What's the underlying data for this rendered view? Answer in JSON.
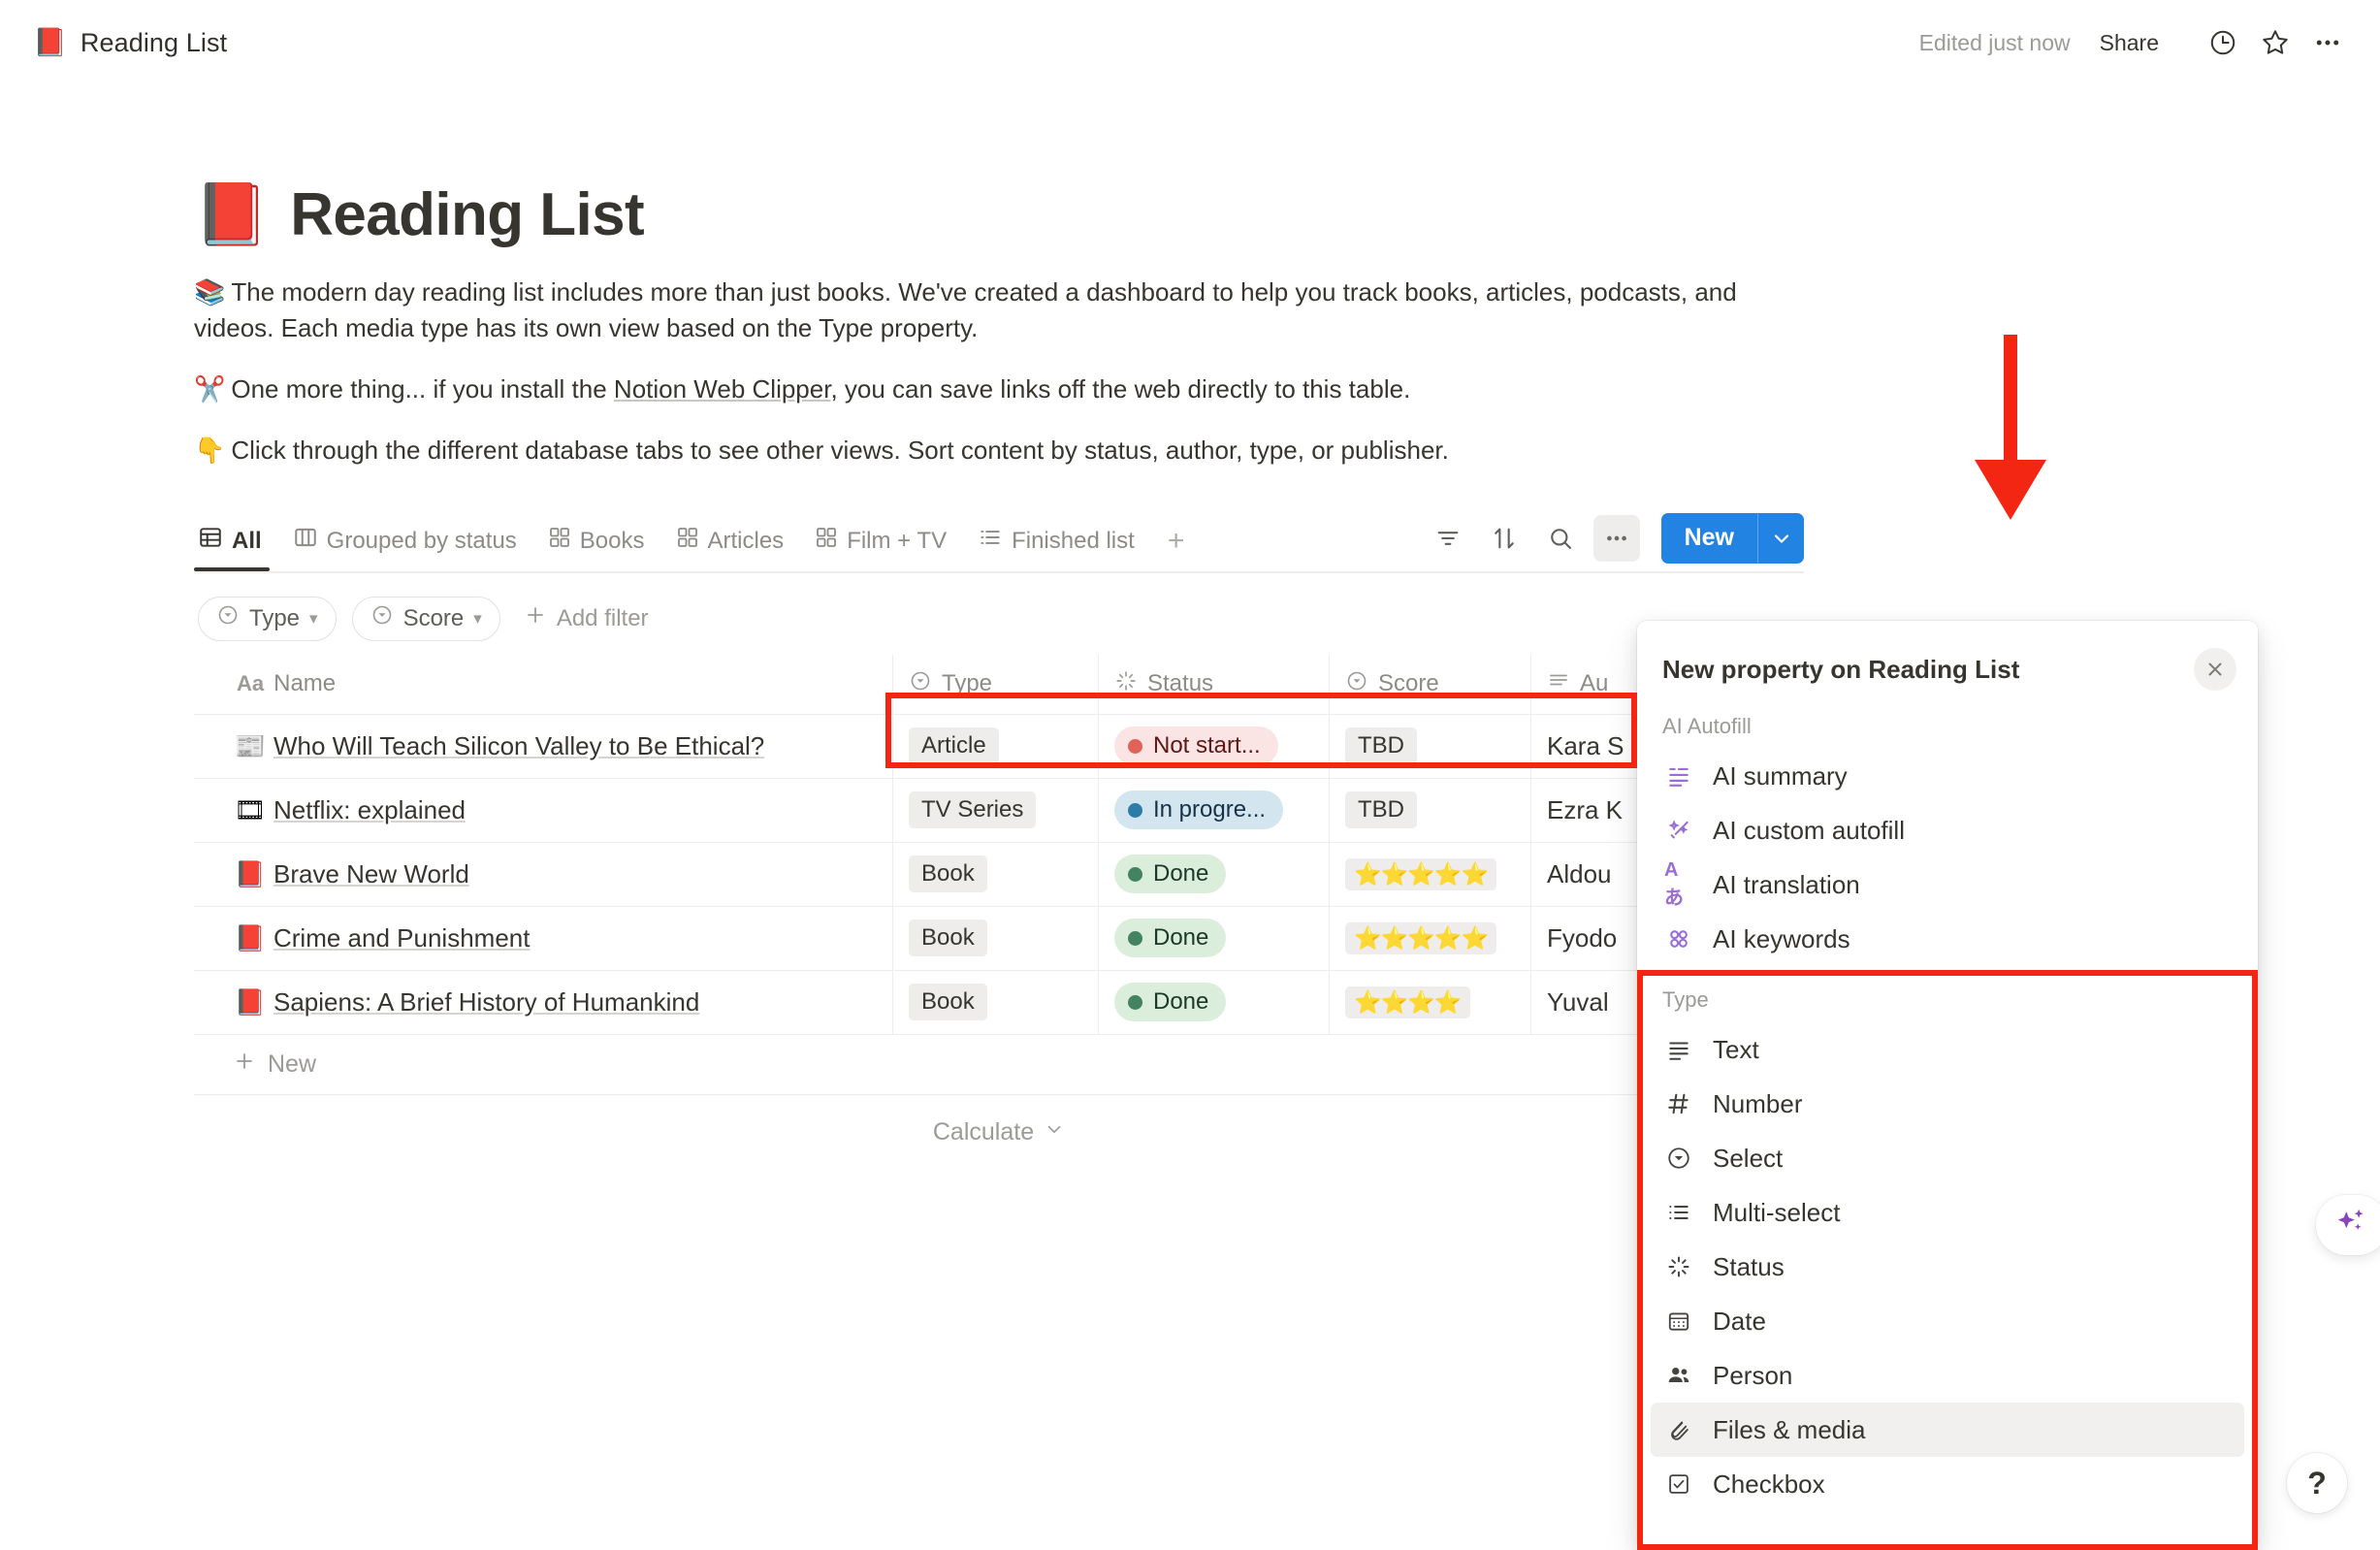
{
  "topbar": {
    "book_icon": "📕",
    "title": "Reading List",
    "edited": "Edited just now",
    "share": "Share",
    "icons": [
      "history-clock-icon",
      "star-icon",
      "more-options-icon"
    ]
  },
  "page": {
    "emoji": "📕",
    "title": "Reading List",
    "paragraphs": [
      {
        "emoji": "📚",
        "text": "The modern day reading list includes more than just books. We've created a dashboard to help you track books, articles, podcasts, and videos. Each media type has its own view based on the Type property."
      },
      {
        "emoji": "✂️",
        "pre": "One more thing... if you install the ",
        "link": "Notion Web Clipper",
        "post": ", you can save links off the web directly to this table."
      },
      {
        "emoji": "👇",
        "text": "Click through the different database tabs to see other views. Sort content by status, author, type, or publisher."
      }
    ]
  },
  "tabs": [
    {
      "label": "All",
      "icon": "table-view-icon",
      "active": true
    },
    {
      "label": "Grouped by status",
      "icon": "board-view-icon",
      "active": false
    },
    {
      "label": "Books",
      "icon": "gallery-view-icon",
      "active": false
    },
    {
      "label": "Articles",
      "icon": "gallery-view-icon",
      "active": false
    },
    {
      "label": "Film + TV",
      "icon": "gallery-view-icon",
      "active": false
    },
    {
      "label": "Finished list",
      "icon": "list-view-icon",
      "active": false
    }
  ],
  "tab_add_label": "+",
  "toolbar": {
    "filter_icon": "filter-icon",
    "sort_icon": "sort-icon",
    "search_icon": "search-icon",
    "more_icon": "more-options-icon",
    "new_label": "New",
    "new_caret": "chevron-down-icon"
  },
  "filters": {
    "chips": [
      {
        "label": "Type",
        "icon": "select-property-icon"
      },
      {
        "label": "Score",
        "icon": "select-property-icon"
      }
    ],
    "add_filter_label": "Add filter"
  },
  "table": {
    "columns": [
      {
        "key": "name",
        "label": "Name",
        "icon": "text-property-icon"
      },
      {
        "key": "type",
        "label": "Type",
        "icon": "select-property-icon"
      },
      {
        "key": "status",
        "label": "Status",
        "icon": "status-property-icon"
      },
      {
        "key": "score",
        "label": "Score",
        "icon": "select-property-icon"
      },
      {
        "key": "author",
        "label": "Au",
        "icon": "multiselect-property-icon"
      }
    ],
    "rows": [
      {
        "icon": "📰",
        "name": "Who Will Teach Silicon Valley to Be Ethical?",
        "type": "Article",
        "status": "Not start...",
        "status_color": "#fbe4e4",
        "status_dot": "#e16259",
        "status_text_color": "#5d1715",
        "score": "TBD",
        "score_kind": "tag",
        "author": "Kara S"
      },
      {
        "icon": "🎞",
        "name": "Netflix: explained",
        "type": "TV Series",
        "status": "In progre...",
        "status_color": "#d3e5ef",
        "status_dot": "#2d7ca8",
        "status_text_color": "#183347",
        "score": "TBD",
        "score_kind": "tag",
        "author": "Ezra K"
      },
      {
        "icon": "📕",
        "name": "Brave New World",
        "type": "Book",
        "status": "Done",
        "status_color": "#dbeddb",
        "status_dot": "#448361",
        "status_text_color": "#1c3829",
        "score": "⭐⭐⭐⭐⭐",
        "score_kind": "stars",
        "author": "Aldou"
      },
      {
        "icon": "📕",
        "name": "Crime and Punishment",
        "type": "Book",
        "status": "Done",
        "status_color": "#dbeddb",
        "status_dot": "#448361",
        "status_text_color": "#1c3829",
        "score": "⭐⭐⭐⭐⭐",
        "score_kind": "stars",
        "author": "Fyodo"
      },
      {
        "icon": "📕",
        "name": "Sapiens: A Brief History of Humankind",
        "type": "Book",
        "status": "Done",
        "status_color": "#dbeddb",
        "status_dot": "#448361",
        "status_text_color": "#1c3829",
        "score": "⭐⭐⭐⭐",
        "score_kind": "stars",
        "author": "Yuval"
      }
    ],
    "new_row_label": "New",
    "calculate_label": "Calculate"
  },
  "popup": {
    "title": "New property on Reading List",
    "close_icon": "close-icon",
    "sections": [
      {
        "label": "AI Autofill",
        "items": [
          {
            "label": "AI summary",
            "icon": "ai-summary-icon",
            "hover": false
          },
          {
            "label": "AI custom autofill",
            "icon": "ai-wand-icon",
            "hover": false
          },
          {
            "label": "AI translation",
            "icon": "ai-translate-icon",
            "hover": false
          },
          {
            "label": "AI keywords",
            "icon": "ai-keywords-icon",
            "hover": false
          }
        ]
      },
      {
        "label": "Type",
        "items": [
          {
            "label": "Text",
            "icon": "text-icon",
            "hover": false
          },
          {
            "label": "Number",
            "icon": "number-icon",
            "hover": false
          },
          {
            "label": "Select",
            "icon": "select-icon",
            "hover": false
          },
          {
            "label": "Multi-select",
            "icon": "multiselect-icon",
            "hover": false
          },
          {
            "label": "Status",
            "icon": "status-icon",
            "hover": false
          },
          {
            "label": "Date",
            "icon": "calendar-icon",
            "hover": false
          },
          {
            "label": "Person",
            "icon": "person-icon",
            "hover": false
          },
          {
            "label": "Files & media",
            "icon": "paperclip-icon",
            "hover": true
          },
          {
            "label": "Checkbox",
            "icon": "checkbox-icon",
            "hover": false
          }
        ]
      }
    ]
  },
  "floating": {
    "ai_icon": "ai-sparkle-icon",
    "help_label": "?"
  },
  "annotations": {
    "color": "#f22613",
    "arrow": "down-arrow-annotation",
    "boxes": [
      "table-header-columns-highlight",
      "property-type-list-highlight"
    ]
  }
}
